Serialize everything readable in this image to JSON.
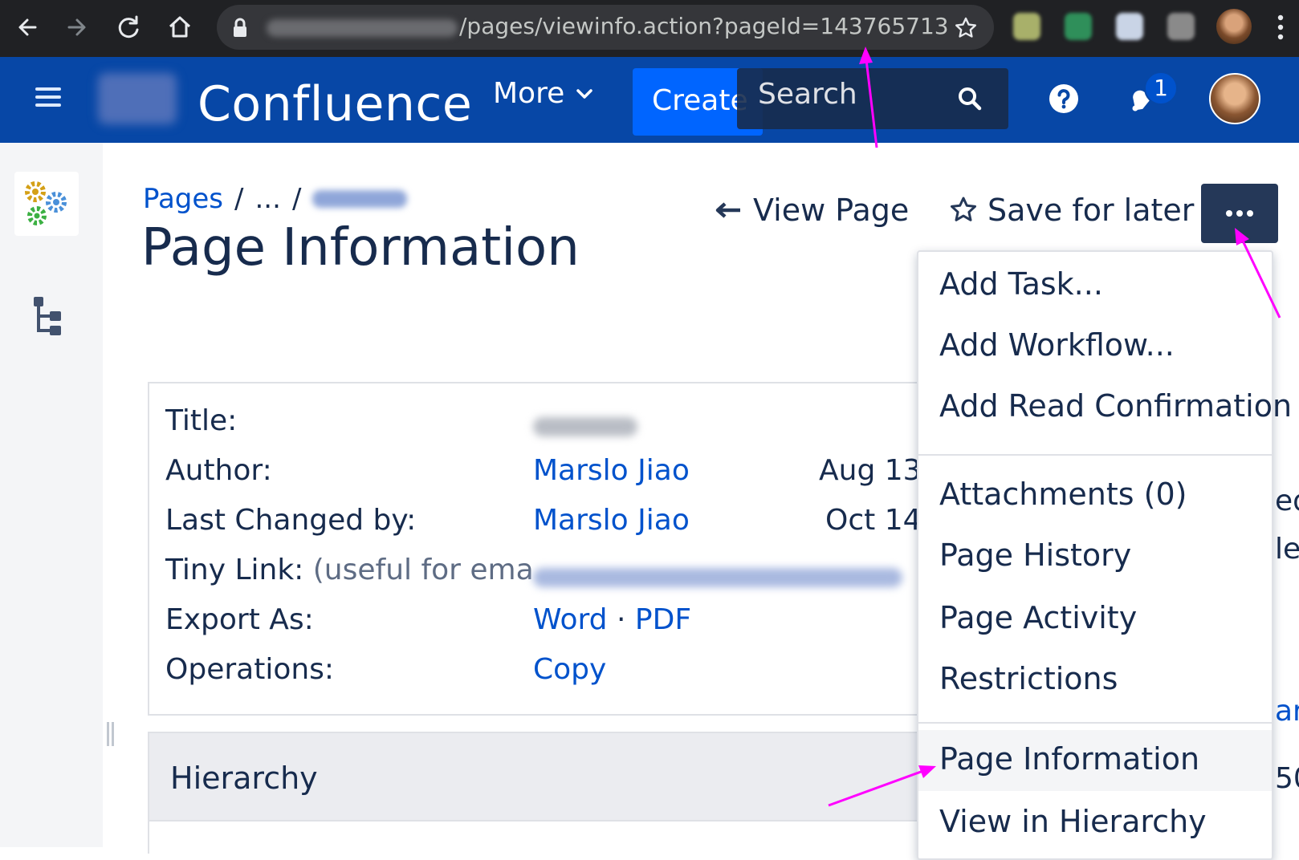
{
  "browser": {
    "url_path": "/pages/viewinfo.action?pageId=143765713",
    "icons": [
      "back-icon",
      "forward-icon",
      "reload-icon",
      "home-icon",
      "lock-icon",
      "bookmark-star-icon",
      "kebab-menu-icon"
    ]
  },
  "header": {
    "brand": "Confluence",
    "more_label": "More",
    "create_label": "Create",
    "search_placeholder": "Search",
    "notification_count": "1",
    "accent_color": "#0747a6"
  },
  "breadcrumb": {
    "root": "Pages",
    "sep1": "/",
    "ellipsis": "...",
    "sep2": "/"
  },
  "page": {
    "title": "Page Information",
    "view_page_label": "View Page",
    "save_for_later_label": "Save for later",
    "more_actions_label": "..."
  },
  "info": {
    "title_label": "Title:",
    "author_label": "Author:",
    "author_value": "Marslo Jiao",
    "author_date": "Aug 13,",
    "last_changed_label": "Last Changed by:",
    "last_changed_value": "Marslo Jiao",
    "last_changed_date": "Oct 14,",
    "tiny_link_label": "Tiny Link:",
    "tiny_link_hint": "(useful for ema",
    "export_label": "Export As:",
    "export_word": "Word",
    "export_dot": "·",
    "export_pdf": "PDF",
    "operations_label": "Operations:",
    "operations_copy": "Copy"
  },
  "hierarchy": {
    "label": "Hierarchy"
  },
  "menu": {
    "group1": [
      "Add Task...",
      "Add Workflow...",
      "Add Read Confirmation"
    ],
    "group2": [
      "Attachments (0)",
      "Page History",
      "Page Activity",
      "Restrictions"
    ],
    "group3": [
      "Page Information",
      "View in Hierarchy"
    ],
    "active_item": "Page Information"
  },
  "annotation": {
    "arrow_color": "#ff00ff"
  }
}
